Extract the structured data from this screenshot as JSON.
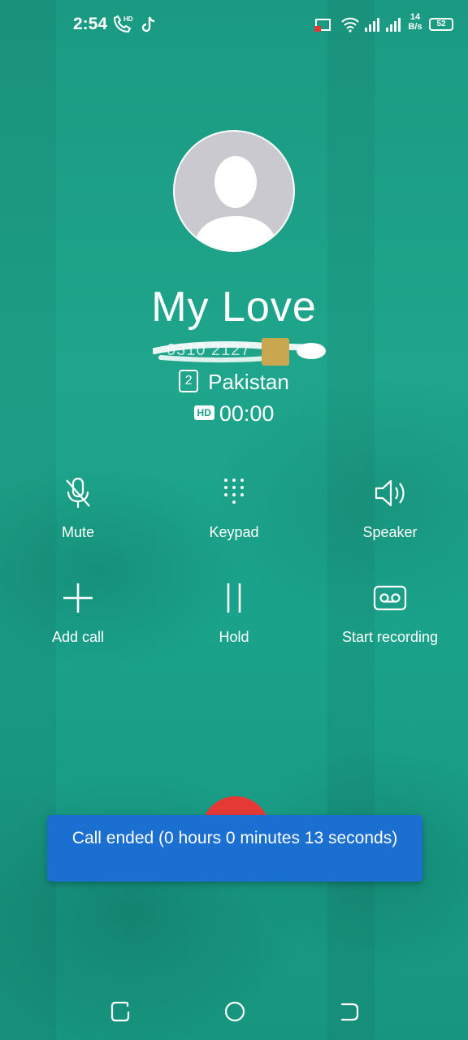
{
  "status_bar": {
    "time": "2:54",
    "call_badge": "HD",
    "network_speed_value": "14",
    "network_speed_unit": "B/s",
    "battery_level": "52"
  },
  "contact": {
    "name": "My Love",
    "number_partial": "0310 2127",
    "sim_slot": "2",
    "location": "Pakistan"
  },
  "call": {
    "hd_label": "HD",
    "duration": "00:00"
  },
  "controls": {
    "mute": "Mute",
    "keypad": "Keypad",
    "speaker": "Speaker",
    "add_call": "Add call",
    "hold": "Hold",
    "start_recording": "Start recording"
  },
  "toast": {
    "message": "Call ended (0 hours 0 minutes 13 seconds)"
  },
  "colors": {
    "background": "#1aa087",
    "end_call": "#e53935",
    "toast": "#1b6fd1"
  }
}
